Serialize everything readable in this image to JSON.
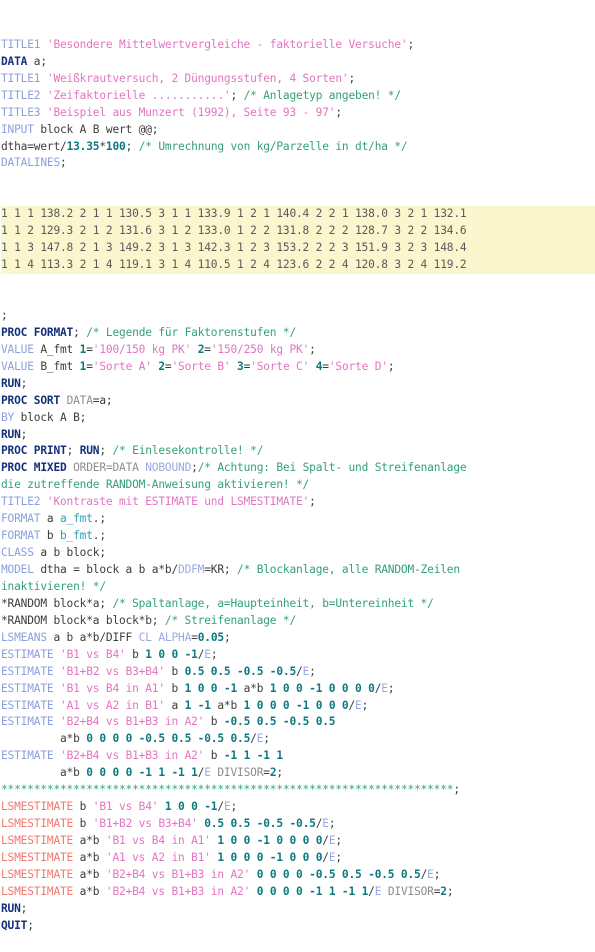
{
  "editor": {
    "language": "SAS",
    "title": "SAS program listing",
    "colors": {
      "background": "#ffffff",
      "keyword": "#13307a",
      "statement": "#8aa0de",
      "string": "#e374c0",
      "comment": "#34a07a",
      "number": "#0d7a80",
      "plain": "#3c3c3c",
      "datalines_highlight": "#fbf6cd",
      "lsmestimate": "#f4766e",
      "format_ref": "#2aa3b8"
    }
  },
  "code": {
    "lines": [
      [
        {
          "t": "TITLE1 ",
          "c": "stmt"
        },
        {
          "t": "'Besondere Mittelwertvergleiche - faktorielle Versuche'",
          "c": "str"
        },
        {
          "t": ";",
          "c": "plain"
        }
      ],
      [
        {
          "t": "DATA",
          "c": "kw"
        },
        {
          "t": " a;",
          "c": "plain"
        }
      ],
      [
        {
          "t": "TITLE1 ",
          "c": "stmt"
        },
        {
          "t": "'Weißkrautversuch, 2 Düngungsstufen, 4 Sorten'",
          "c": "str"
        },
        {
          "t": ";",
          "c": "plain"
        }
      ],
      [
        {
          "t": "TITLE2 ",
          "c": "stmt"
        },
        {
          "t": "'Zeifaktorielle ...........'",
          "c": "str"
        },
        {
          "t": "; ",
          "c": "plain"
        },
        {
          "t": "/* Anlagetyp angeben! */",
          "c": "cmt"
        }
      ],
      [
        {
          "t": "TITLE3 ",
          "c": "stmt"
        },
        {
          "t": "'Beispiel aus Munzert (1992), Seite 93 - 97'",
          "c": "str"
        },
        {
          "t": ";",
          "c": "plain"
        }
      ],
      [
        {
          "t": "INPUT",
          "c": "stmt"
        },
        {
          "t": " block A B wert @@;",
          "c": "plain"
        }
      ],
      [
        {
          "t": "dtha=wert/",
          "c": "plain"
        },
        {
          "t": "13.35",
          "c": "num"
        },
        {
          "t": "*",
          "c": "plain"
        },
        {
          "t": "100",
          "c": "num"
        },
        {
          "t": "; ",
          "c": "plain"
        },
        {
          "t": "/* Umrechnung von kg/Parzelle in dt/ha */",
          "c": "cmt"
        }
      ],
      [
        {
          "t": "DATALINES",
          "c": "stmt"
        },
        {
          "t": ";",
          "c": "plain"
        }
      ]
    ],
    "datalines": [
      "1 1 1 138.2 2 1 1 130.5 3 1 1 133.9 1 2 1 140.4 2 2 1 138.0 3 2 1 132.1",
      "1 1 2 129.3 2 1 2 131.6 3 1 2 133.0 1 2 2 131.8 2 2 2 128.7 3 2 2 134.6",
      "1 1 3 147.8 2 1 3 149.2 3 1 3 142.3 1 2 3 153.2 2 2 3 151.9 3 2 3 148.4",
      "1 1 4 113.3 2 1 4 119.1 3 1 4 110.5 1 2 4 123.6 2 2 4 120.8 3 2 4 119.2"
    ],
    "lines2": [
      [
        {
          "t": ";",
          "c": "plain"
        }
      ],
      [
        {
          "t": "PROC FORMAT",
          "c": "kw"
        },
        {
          "t": "; ",
          "c": "plain"
        },
        {
          "t": "/* Legende für Faktorenstufen */",
          "c": "cmt"
        }
      ],
      [
        {
          "t": "VALUE",
          "c": "stmt"
        },
        {
          "t": " A_fmt ",
          "c": "plain"
        },
        {
          "t": "1",
          "c": "num"
        },
        {
          "t": "=",
          "c": "plain"
        },
        {
          "t": "'100/150 kg PK'",
          "c": "str"
        },
        {
          "t": " ",
          "c": "plain"
        },
        {
          "t": "2",
          "c": "num"
        },
        {
          "t": "=",
          "c": "plain"
        },
        {
          "t": "'150/250 kg PK'",
          "c": "str"
        },
        {
          "t": ";",
          "c": "plain"
        }
      ],
      [
        {
          "t": "VALUE",
          "c": "stmt"
        },
        {
          "t": " B_fmt ",
          "c": "plain"
        },
        {
          "t": "1",
          "c": "num"
        },
        {
          "t": "=",
          "c": "plain"
        },
        {
          "t": "'Sorte A'",
          "c": "str"
        },
        {
          "t": " ",
          "c": "plain"
        },
        {
          "t": "2",
          "c": "num"
        },
        {
          "t": "=",
          "c": "plain"
        },
        {
          "t": "'Sorte B'",
          "c": "str"
        },
        {
          "t": " ",
          "c": "plain"
        },
        {
          "t": "3",
          "c": "num"
        },
        {
          "t": "=",
          "c": "plain"
        },
        {
          "t": "'Sorte C'",
          "c": "str"
        },
        {
          "t": " ",
          "c": "plain"
        },
        {
          "t": "4",
          "c": "num"
        },
        {
          "t": "=",
          "c": "plain"
        },
        {
          "t": "'Sorte D'",
          "c": "str"
        },
        {
          "t": ";",
          "c": "plain"
        }
      ],
      [
        {
          "t": "RUN",
          "c": "kw"
        },
        {
          "t": ";",
          "c": "plain"
        }
      ],
      [
        {
          "t": "PROC SORT",
          "c": "kw"
        },
        {
          "t": " ",
          "c": "plain"
        },
        {
          "t": "DATA",
          "c": "gray"
        },
        {
          "t": "=a;",
          "c": "plain"
        }
      ],
      [
        {
          "t": "BY",
          "c": "stmt"
        },
        {
          "t": " block A B;",
          "c": "plain"
        }
      ],
      [
        {
          "t": "RUN",
          "c": "kw"
        },
        {
          "t": ";",
          "c": "plain"
        }
      ],
      [
        {
          "t": "PROC PRINT",
          "c": "kw"
        },
        {
          "t": "; ",
          "c": "plain"
        },
        {
          "t": "RUN",
          "c": "kw"
        },
        {
          "t": "; ",
          "c": "plain"
        },
        {
          "t": "/* Einlesekontrolle! */",
          "c": "cmt"
        }
      ],
      [
        {
          "t": "PROC MIXED",
          "c": "kw"
        },
        {
          "t": " ",
          "c": "plain"
        },
        {
          "t": "ORDER=DATA",
          "c": "gray"
        },
        {
          "t": " ",
          "c": "plain"
        },
        {
          "t": "NOBOUND",
          "c": "opt"
        },
        {
          "t": ";",
          "c": "plain"
        },
        {
          "t": "/* Achtung: Bei Spalt- und Streifenanlage",
          "c": "cmt"
        }
      ],
      [
        {
          "t": "die zutreffende RANDOM-Anweisung aktivieren! */",
          "c": "cmt"
        }
      ],
      [
        {
          "t": "TITLE2 ",
          "c": "stmt"
        },
        {
          "t": "'Kontraste mit ESTIMATE und LSMESTIMATE'",
          "c": "str"
        },
        {
          "t": ";",
          "c": "plain"
        }
      ],
      [
        {
          "t": "FORMAT",
          "c": "stmt"
        },
        {
          "t": " a ",
          "c": "plain"
        },
        {
          "t": "a_fmt",
          "c": "fmtname"
        },
        {
          "t": ".;",
          "c": "plain"
        }
      ],
      [
        {
          "t": "FORMAT",
          "c": "stmt"
        },
        {
          "t": " b ",
          "c": "plain"
        },
        {
          "t": "b_fmt",
          "c": "fmtname"
        },
        {
          "t": ".;",
          "c": "plain"
        }
      ],
      [
        {
          "t": "CLASS",
          "c": "stmt"
        },
        {
          "t": " a b block;",
          "c": "plain"
        }
      ],
      [
        {
          "t": "MODEL",
          "c": "stmt"
        },
        {
          "t": " dtha = block a b a*b/",
          "c": "plain"
        },
        {
          "t": "DDFM",
          "c": "opt"
        },
        {
          "t": "=KR; ",
          "c": "plain"
        },
        {
          "t": "/* Blockanlage, alle RANDOM-Zeilen",
          "c": "cmt"
        }
      ],
      [
        {
          "t": "inaktivieren! */",
          "c": "cmt"
        }
      ],
      [
        {
          "t": "*RANDOM block*a; ",
          "c": "plain"
        },
        {
          "t": "/* Spaltanlage, a=Haupteinheit, b=Untereinheit */",
          "c": "cmt"
        }
      ],
      [
        {
          "t": "*RANDOM block*a block*b; ",
          "c": "plain"
        },
        {
          "t": "/* Streifenanlage */",
          "c": "cmt"
        }
      ],
      [
        {
          "t": "LSMEANS",
          "c": "stmt"
        },
        {
          "t": " a b a*b/",
          "c": "plain"
        },
        {
          "t": "DIFF",
          "c": "plain"
        },
        {
          "t": " ",
          "c": "plain"
        },
        {
          "t": "CL",
          "c": "opt"
        },
        {
          "t": " ",
          "c": "plain"
        },
        {
          "t": "ALPHA",
          "c": "opt"
        },
        {
          "t": "=",
          "c": "plain"
        },
        {
          "t": "0.05",
          "c": "num"
        },
        {
          "t": ";",
          "c": "plain"
        }
      ],
      [
        {
          "t": "ESTIMATE",
          "c": "stmt"
        },
        {
          "t": " ",
          "c": "plain"
        },
        {
          "t": "'B1 vs B4'",
          "c": "str"
        },
        {
          "t": " b ",
          "c": "plain"
        },
        {
          "t": "1 0 0 -1",
          "c": "num"
        },
        {
          "t": "/",
          "c": "plain"
        },
        {
          "t": "E",
          "c": "opt"
        },
        {
          "t": ";",
          "c": "plain"
        }
      ],
      [
        {
          "t": "ESTIMATE",
          "c": "stmt"
        },
        {
          "t": " ",
          "c": "plain"
        },
        {
          "t": "'B1+B2 vs B3+B4'",
          "c": "str"
        },
        {
          "t": " b ",
          "c": "plain"
        },
        {
          "t": "0.5 0.5 -0.5 -0.5",
          "c": "num"
        },
        {
          "t": "/",
          "c": "plain"
        },
        {
          "t": "E",
          "c": "opt"
        },
        {
          "t": ";",
          "c": "plain"
        }
      ],
      [
        {
          "t": "ESTIMATE",
          "c": "stmt"
        },
        {
          "t": " ",
          "c": "plain"
        },
        {
          "t": "'B1 vs B4 in A1'",
          "c": "str"
        },
        {
          "t": " b ",
          "c": "plain"
        },
        {
          "t": "1 0 0 -1",
          "c": "num"
        },
        {
          "t": " a*b ",
          "c": "plain"
        },
        {
          "t": "1 0 0 -1 0 0 0 0",
          "c": "num"
        },
        {
          "t": "/",
          "c": "plain"
        },
        {
          "t": "E",
          "c": "opt"
        },
        {
          "t": ";",
          "c": "plain"
        }
      ],
      [
        {
          "t": "ESTIMATE",
          "c": "stmt"
        },
        {
          "t": " ",
          "c": "plain"
        },
        {
          "t": "'A1 vs A2 in B1'",
          "c": "str"
        },
        {
          "t": " a ",
          "c": "plain"
        },
        {
          "t": "1 -1",
          "c": "num"
        },
        {
          "t": " a*b ",
          "c": "plain"
        },
        {
          "t": "1 0 0 0 -1 0 0 0",
          "c": "num"
        },
        {
          "t": "/",
          "c": "plain"
        },
        {
          "t": "E",
          "c": "opt"
        },
        {
          "t": ";",
          "c": "plain"
        }
      ],
      [
        {
          "t": "ESTIMATE",
          "c": "stmt"
        },
        {
          "t": " ",
          "c": "plain"
        },
        {
          "t": "'B2+B4 vs B1+B3 in A2'",
          "c": "str"
        },
        {
          "t": " b ",
          "c": "plain"
        },
        {
          "t": "-0.5 0.5 -0.5 0.5",
          "c": "num"
        }
      ],
      [
        {
          "t": "         a*b ",
          "c": "plain"
        },
        {
          "t": "0 0 0 0 -0.5 0.5 -0.5 0.5",
          "c": "num"
        },
        {
          "t": "/",
          "c": "plain"
        },
        {
          "t": "E",
          "c": "opt"
        },
        {
          "t": ";",
          "c": "plain"
        }
      ],
      [
        {
          "t": "ESTIMATE",
          "c": "stmt"
        },
        {
          "t": " ",
          "c": "plain"
        },
        {
          "t": "'B2+B4 vs B1+B3 in A2'",
          "c": "str"
        },
        {
          "t": " b ",
          "c": "plain"
        },
        {
          "t": "-1 1 -1 1",
          "c": "num"
        }
      ],
      [
        {
          "t": "         a*b ",
          "c": "plain"
        },
        {
          "t": "0 0 0 0 -1 1 -1 1",
          "c": "num"
        },
        {
          "t": "/",
          "c": "plain"
        },
        {
          "t": "E",
          "c": "opt"
        },
        {
          "t": " ",
          "c": "plain"
        },
        {
          "t": "DIVISOR",
          "c": "gray"
        },
        {
          "t": "=",
          "c": "plain"
        },
        {
          "t": "2",
          "c": "num"
        },
        {
          "t": ";",
          "c": "plain"
        }
      ],
      [
        {
          "t": "*********************************************************************",
          "c": "cmt"
        },
        {
          "t": ";",
          "c": "plain"
        }
      ],
      [
        {
          "t": "LSMESTIMATE",
          "c": "lsm"
        },
        {
          "t": " b ",
          "c": "plain"
        },
        {
          "t": "'B1 vs B4'",
          "c": "str"
        },
        {
          "t": " ",
          "c": "plain"
        },
        {
          "t": "1 0 0 -1",
          "c": "num"
        },
        {
          "t": "/",
          "c": "plain"
        },
        {
          "t": "E",
          "c": "opt"
        },
        {
          "t": ";",
          "c": "plain"
        }
      ],
      [
        {
          "t": "LSMESTIMATE",
          "c": "lsm"
        },
        {
          "t": " b ",
          "c": "plain"
        },
        {
          "t": "'B1+B2 vs B3+B4'",
          "c": "str"
        },
        {
          "t": " ",
          "c": "plain"
        },
        {
          "t": "0.5 0.5 -0.5 -0.5",
          "c": "num"
        },
        {
          "t": "/",
          "c": "plain"
        },
        {
          "t": "E",
          "c": "opt"
        },
        {
          "t": ";",
          "c": "plain"
        }
      ],
      [
        {
          "t": "LSMESTIMATE",
          "c": "lsm"
        },
        {
          "t": " a*b ",
          "c": "plain"
        },
        {
          "t": "'B1 vs B4 in A1'",
          "c": "str"
        },
        {
          "t": " ",
          "c": "plain"
        },
        {
          "t": "1 0 0 -1 0 0 0 0",
          "c": "num"
        },
        {
          "t": "/",
          "c": "plain"
        },
        {
          "t": "E",
          "c": "opt"
        },
        {
          "t": ";",
          "c": "plain"
        }
      ],
      [
        {
          "t": "LSMESTIMATE",
          "c": "lsm"
        },
        {
          "t": " a*b ",
          "c": "plain"
        },
        {
          "t": "'A1 vs A2 in B1'",
          "c": "str"
        },
        {
          "t": " ",
          "c": "plain"
        },
        {
          "t": "1 0 0 0 -1 0 0 0",
          "c": "num"
        },
        {
          "t": "/",
          "c": "plain"
        },
        {
          "t": "E",
          "c": "opt"
        },
        {
          "t": ";",
          "c": "plain"
        }
      ],
      [
        {
          "t": "LSMESTIMATE",
          "c": "lsm"
        },
        {
          "t": " a*b ",
          "c": "plain"
        },
        {
          "t": "'B2+B4 vs B1+B3 in A2'",
          "c": "str"
        },
        {
          "t": " ",
          "c": "plain"
        },
        {
          "t": "0 0 0 0 -0.5 0.5 -0.5 0.5",
          "c": "num"
        },
        {
          "t": "/",
          "c": "plain"
        },
        {
          "t": "E",
          "c": "opt"
        },
        {
          "t": ";",
          "c": "plain"
        }
      ],
      [
        {
          "t": "LSMESTIMATE",
          "c": "lsm"
        },
        {
          "t": " a*b ",
          "c": "plain"
        },
        {
          "t": "'B2+B4 vs B1+B3 in A2'",
          "c": "str"
        },
        {
          "t": " ",
          "c": "plain"
        },
        {
          "t": "0 0 0 0 -1 1 -1 1",
          "c": "num"
        },
        {
          "t": "/",
          "c": "plain"
        },
        {
          "t": "E",
          "c": "opt"
        },
        {
          "t": " ",
          "c": "plain"
        },
        {
          "t": "DIVISOR",
          "c": "gray"
        },
        {
          "t": "=",
          "c": "plain"
        },
        {
          "t": "2",
          "c": "num"
        },
        {
          "t": ";",
          "c": "plain"
        }
      ],
      [
        {
          "t": "RUN",
          "c": "kw"
        },
        {
          "t": ";",
          "c": "plain"
        }
      ],
      [
        {
          "t": "QUIT",
          "c": "kw"
        },
        {
          "t": ";",
          "c": "plain"
        }
      ]
    ]
  }
}
